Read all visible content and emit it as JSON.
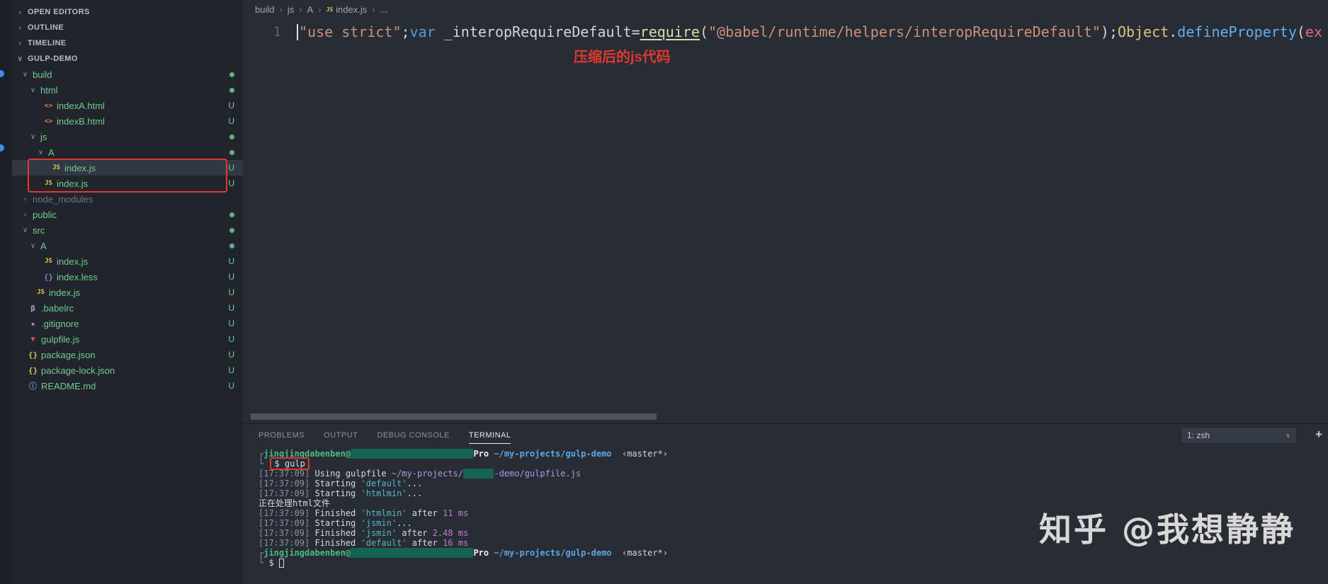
{
  "colors": {
    "annotation_red": "#e0382e",
    "git_green": "#73c991",
    "terminal_green": "#45bd85",
    "path_blue": "#5ca7e4",
    "task_cyan": "#56b6c2",
    "duration_magenta": "#c678dd",
    "redaction_teal": "#156353"
  },
  "icons": {
    "js": "JS",
    "html": "<>",
    "less": "{}",
    "babel": "β",
    "git": "◆",
    "gulp": "▼",
    "json": "{}",
    "info": "ⓘ"
  },
  "sidebar": {
    "sections": [
      {
        "label": "OPEN EDITORS",
        "expanded": false
      },
      {
        "label": "OUTLINE",
        "expanded": false
      },
      {
        "label": "TIMELINE",
        "expanded": false
      },
      {
        "label": "GULP-DEMO",
        "expanded": true
      }
    ],
    "tree": [
      {
        "label": "build",
        "kind": "folder",
        "expanded": true,
        "depth": 0,
        "badge": "dot"
      },
      {
        "label": "html",
        "kind": "folder",
        "expanded": true,
        "depth": 1,
        "badge": "dot"
      },
      {
        "label": "indexA.html",
        "kind": "file",
        "icon": "html",
        "depth": 2,
        "badge": "U"
      },
      {
        "label": "indexB.html",
        "kind": "file",
        "icon": "html",
        "depth": 2,
        "badge": "U"
      },
      {
        "label": "js",
        "kind": "folder",
        "expanded": true,
        "depth": 1,
        "badge": "dot"
      },
      {
        "label": "A",
        "kind": "folder",
        "expanded": true,
        "depth": 2,
        "badge": "dot"
      },
      {
        "label": "index.js",
        "kind": "file",
        "icon": "js",
        "depth": 3,
        "badge": "U",
        "selected": true
      },
      {
        "label": "index.js",
        "kind": "file",
        "icon": "js",
        "depth": 2,
        "badge": "U"
      },
      {
        "label": "node_modules",
        "kind": "folder",
        "expanded": false,
        "depth": 0,
        "badge": "",
        "ignored": true
      },
      {
        "label": "public",
        "kind": "folder",
        "expanded": false,
        "depth": 0,
        "badge": "dot"
      },
      {
        "label": "src",
        "kind": "folder",
        "expanded": true,
        "depth": 0,
        "badge": "dot"
      },
      {
        "label": "A",
        "kind": "folder",
        "expanded": true,
        "depth": 1,
        "badge": "dot"
      },
      {
        "label": "index.js",
        "kind": "file",
        "icon": "js",
        "depth": 2,
        "badge": "U"
      },
      {
        "label": "index.less",
        "kind": "file",
        "icon": "less",
        "depth": 2,
        "badge": "U"
      },
      {
        "label": "index.js",
        "kind": "file",
        "icon": "js",
        "depth": 1,
        "badge": "U"
      },
      {
        "label": ".babelrc",
        "kind": "file",
        "icon": "babel",
        "depth": 0,
        "badge": "U"
      },
      {
        "label": ".gitignore",
        "kind": "file",
        "icon": "git",
        "depth": 0,
        "badge": "U"
      },
      {
        "label": "gulpfile.js",
        "kind": "file",
        "icon": "gulp",
        "depth": 0,
        "badge": "U"
      },
      {
        "label": "package.json",
        "kind": "file",
        "icon": "json",
        "depth": 0,
        "badge": "U"
      },
      {
        "label": "package-lock.json",
        "kind": "file",
        "icon": "json",
        "depth": 0,
        "badge": "U"
      },
      {
        "label": "README.md",
        "kind": "file",
        "icon": "info",
        "depth": 0,
        "badge": "U"
      }
    ]
  },
  "editor": {
    "breadcrumbs": [
      {
        "label": "build"
      },
      {
        "label": "js"
      },
      {
        "label": "A"
      },
      {
        "label": "index.js",
        "icon": "js"
      },
      {
        "label": "..."
      }
    ],
    "line_number": "1",
    "code_tokens": [
      {
        "t": "\"use strict\"",
        "c": "str"
      },
      {
        "t": ";",
        "c": "pun"
      },
      {
        "t": "var",
        "c": "kw"
      },
      {
        "t": " _interopRequireDefault",
        "c": "id"
      },
      {
        "t": "=",
        "c": "op"
      },
      {
        "t": "require",
        "c": "fn"
      },
      {
        "t": "(",
        "c": "pun"
      },
      {
        "t": "\"@babel/runtime/helpers/interopRequireDefault\"",
        "c": "str"
      },
      {
        "t": ")",
        "c": "pun"
      },
      {
        "t": ";",
        "c": "pun"
      },
      {
        "t": "Object",
        "c": "cls"
      },
      {
        "t": ".",
        "c": "pun"
      },
      {
        "t": "defineProperty",
        "c": "fn2"
      },
      {
        "t": "(",
        "c": "pun"
      },
      {
        "t": "ex",
        "c": "str2"
      }
    ],
    "annotation": "压缩后的js代码"
  },
  "panel": {
    "tabs": [
      "PROBLEMS",
      "OUTPUT",
      "DEBUG CONSOLE",
      "TERMINAL"
    ],
    "active_tab": "TERMINAL",
    "shell_select": "1: zsh",
    "new_terminal_label": "+",
    "terminal_lines": [
      [
        {
          "t": "┌",
          "c": "pm"
        },
        {
          "t": "jingjingdabenben@",
          "c": "user"
        },
        {
          "t": "                        ",
          "c": "redact"
        },
        {
          "t": "Pro",
          "c": "pro"
        },
        {
          "t": " ~/my-projects/gulp-demo",
          "c": "path"
        },
        {
          "t": "  ‹master*›",
          "c": "branch"
        }
      ],
      [
        {
          "t": "└ ",
          "c": "pm"
        },
        {
          "t": "$ gulp",
          "c": "plain",
          "box": true
        }
      ],
      [
        {
          "t": "[17:37:09]",
          "c": "dim"
        },
        {
          "t": " Using gulpfile ",
          "c": "plain"
        },
        {
          "t": "~/my-projects/",
          "c": "gpath"
        },
        {
          "t": "      ",
          "c": "redact"
        },
        {
          "t": "-demo/gulpfile.js",
          "c": "gpath"
        }
      ],
      [
        {
          "t": "[17:37:09]",
          "c": "dim"
        },
        {
          "t": " Starting ",
          "c": "plain"
        },
        {
          "t": "'default'",
          "c": "task"
        },
        {
          "t": "...",
          "c": "plain"
        }
      ],
      [
        {
          "t": "[17:37:09]",
          "c": "dim"
        },
        {
          "t": " Starting ",
          "c": "plain"
        },
        {
          "t": "'htmlmin'",
          "c": "task"
        },
        {
          "t": "...",
          "c": "plain"
        }
      ],
      [
        {
          "t": "正在处理html文件",
          "c": "plain"
        }
      ],
      [
        {
          "t": "[17:37:09]",
          "c": "dim"
        },
        {
          "t": " Finished ",
          "c": "plain"
        },
        {
          "t": "'htmlmin'",
          "c": "task"
        },
        {
          "t": " after ",
          "c": "plain"
        },
        {
          "t": "11 ms",
          "c": "dur"
        }
      ],
      [
        {
          "t": "[17:37:09]",
          "c": "dim"
        },
        {
          "t": " Starting ",
          "c": "plain"
        },
        {
          "t": "'jsmin'",
          "c": "task"
        },
        {
          "t": "...",
          "c": "plain"
        }
      ],
      [
        {
          "t": "[17:37:09]",
          "c": "dim"
        },
        {
          "t": " Finished ",
          "c": "plain"
        },
        {
          "t": "'jsmin'",
          "c": "task"
        },
        {
          "t": " after ",
          "c": "plain"
        },
        {
          "t": "2.48 ms",
          "c": "dur"
        }
      ],
      [
        {
          "t": "[17:37:09]",
          "c": "dim"
        },
        {
          "t": " Finished ",
          "c": "plain"
        },
        {
          "t": "'default'",
          "c": "task"
        },
        {
          "t": " after ",
          "c": "plain"
        },
        {
          "t": "16 ms",
          "c": "dur"
        }
      ],
      [
        {
          "t": "┌",
          "c": "pm"
        },
        {
          "t": "jingjingdabenben@",
          "c": "user"
        },
        {
          "t": "                        ",
          "c": "redact"
        },
        {
          "t": "Pro",
          "c": "pro"
        },
        {
          "t": " ~/my-projects/gulp-demo",
          "c": "path"
        },
        {
          "t": "  ‹master*›",
          "c": "branch"
        }
      ],
      [
        {
          "t": "└ ",
          "c": "pm"
        },
        {
          "t": "$ ",
          "c": "plain"
        },
        {
          "t": " ",
          "c": "cursor"
        }
      ]
    ]
  },
  "watermark": "知乎 @我想静静"
}
